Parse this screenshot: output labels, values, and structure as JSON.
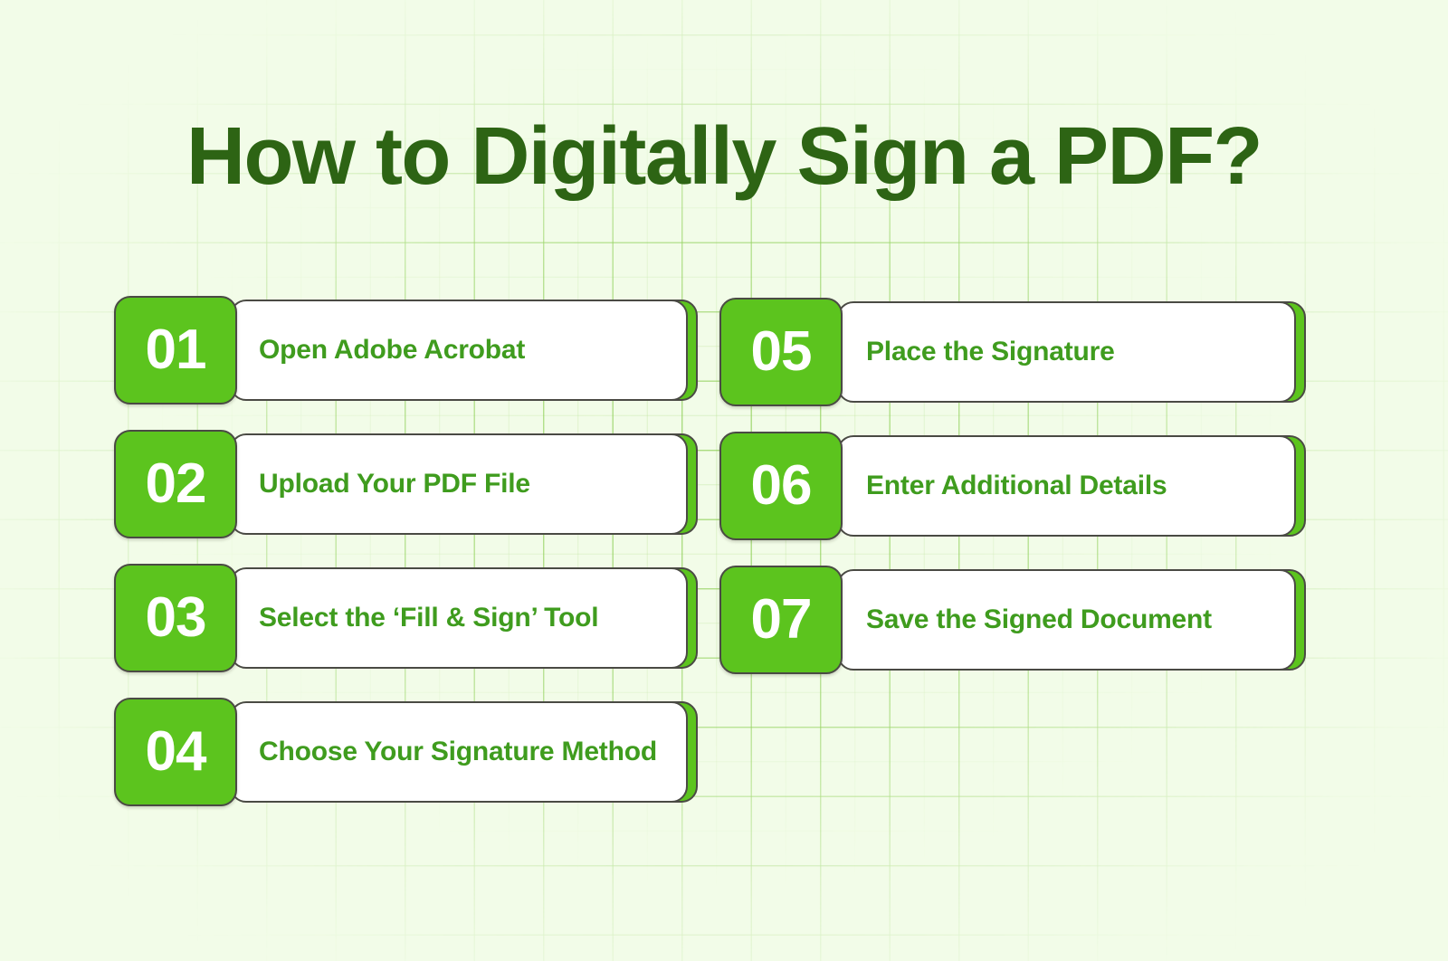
{
  "title": "How to Digitally Sign a PDF?",
  "colors": {
    "background": "#f2fce8",
    "grid_line": "#7cc83c",
    "title_text": "#2d6414",
    "badge_fill": "#5cc41e",
    "badge_number_text": "#ffffff",
    "card_fill": "#ffffff",
    "card_outline": "#4a4a44",
    "card_label_text": "#3f9c1e"
  },
  "steps": {
    "left_column": [
      {
        "number": "01",
        "label": "Open Adobe Acrobat"
      },
      {
        "number": "02",
        "label": "Upload Your PDF File"
      },
      {
        "number": "03",
        "label": "Select the ‘Fill & Sign’ Tool"
      },
      {
        "number": "04",
        "label": "Choose Your Signature Method"
      }
    ],
    "right_column": [
      {
        "number": "05",
        "label": "Place the Signature"
      },
      {
        "number": "06",
        "label": "Enter Additional Details"
      },
      {
        "number": "07",
        "label": "Save the Signed Document"
      }
    ]
  }
}
